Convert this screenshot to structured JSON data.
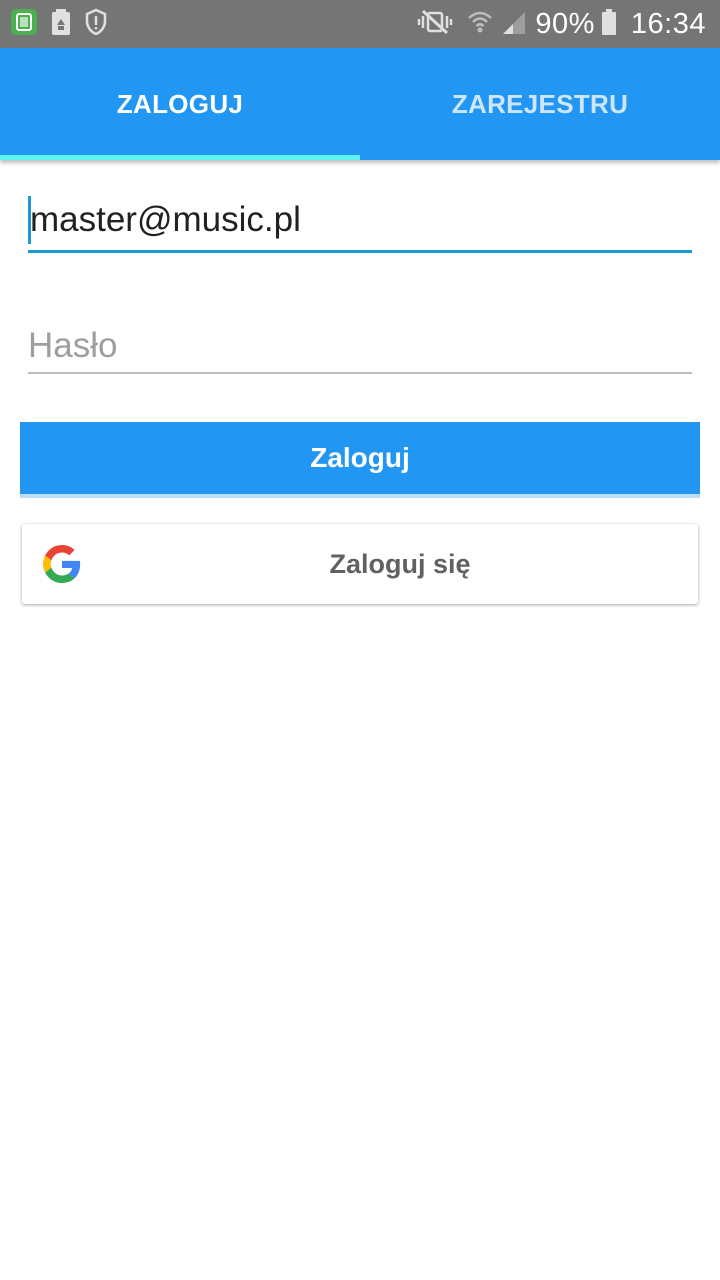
{
  "status_bar": {
    "icons_left": [
      "screen-mirror-icon",
      "recycle-icon",
      "shield-alert-icon"
    ],
    "icons_right": [
      "vibrate-mute-icon",
      "wifi-icon",
      "signal-icon",
      "battery-icon"
    ],
    "battery": "90%",
    "time": "16:34"
  },
  "tabs": [
    {
      "label": "ZALOGUJ",
      "active": true
    },
    {
      "label": "ZAREJESTRU",
      "active": false
    }
  ],
  "form": {
    "email_value": "master@music.pl",
    "password_placeholder": "Hasło",
    "login_button": "Zaloguj",
    "google_button": "Zaloguj się"
  },
  "colors": {
    "primary": "#2196f3",
    "tab_indicator": "#5ff2f2",
    "field_focus": "#1e9ad2",
    "status_bar": "#757575"
  }
}
